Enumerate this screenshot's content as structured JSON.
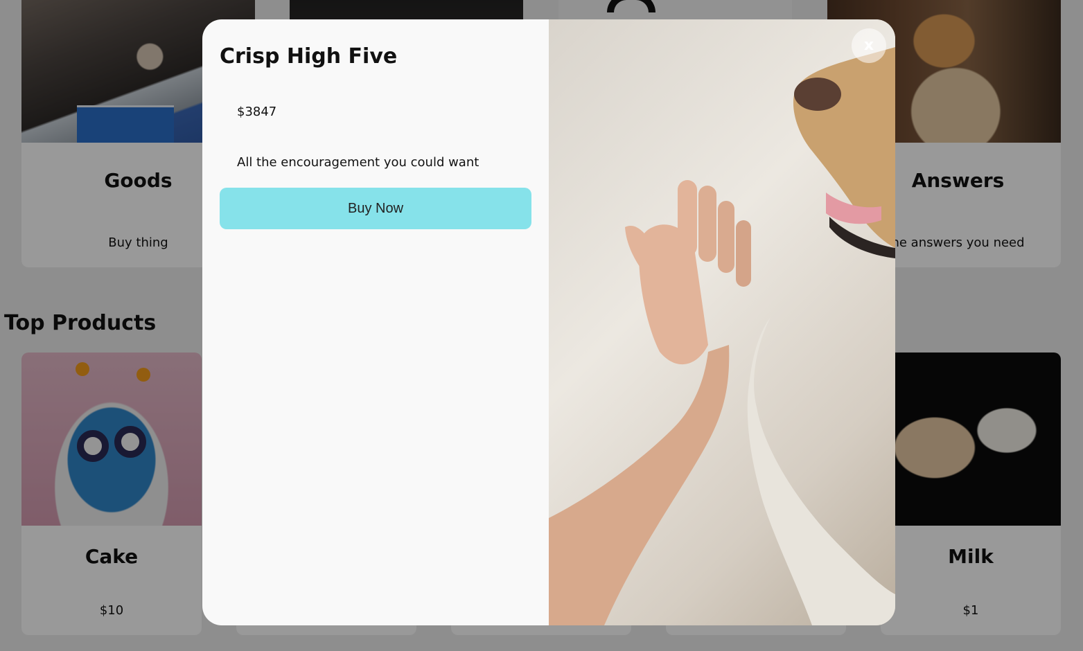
{
  "categories": [
    {
      "title": "Goods",
      "subtitle": "Buy thing"
    },
    {
      "title": "",
      "subtitle": ""
    },
    {
      "title": "",
      "subtitle": ""
    },
    {
      "title": "Answers",
      "subtitle": "he answers you need"
    }
  ],
  "section": {
    "title": "Top Products"
  },
  "products": [
    {
      "name": "Cake",
      "price": "$10"
    },
    {
      "name": "",
      "price": ""
    },
    {
      "name": "",
      "price": ""
    },
    {
      "name": "",
      "price": ""
    },
    {
      "name": "Milk",
      "price": "$1"
    }
  ],
  "modal": {
    "title": "Crisp High Five",
    "price": "$3847",
    "description": "All the encouragement you could want",
    "buy_label": "Buy Now",
    "close_label": "x",
    "image_icon": "dog-high-five-photo"
  },
  "colors": {
    "buy_button": "#86e2ea",
    "overlay": "rgba(0,0,0,0.40)",
    "modal_bg": "#f9f9f9"
  }
}
